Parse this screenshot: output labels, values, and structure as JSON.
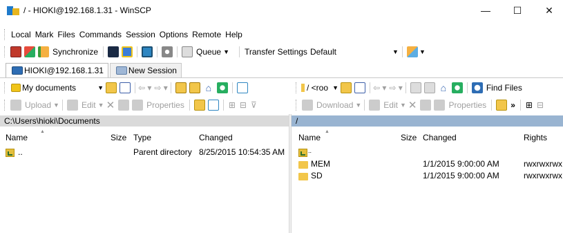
{
  "window": {
    "title": "/ - HIOKI@192.168.1.31 - WinSCP",
    "minimize": "—",
    "maximize": "☐",
    "close": "✕"
  },
  "menu": [
    "Local",
    "Mark",
    "Files",
    "Commands",
    "Session",
    "Options",
    "Remote",
    "Help"
  ],
  "toolbar": {
    "synchronize": "Synchronize",
    "queue": "Queue",
    "transfer_settings_label": "Transfer Settings",
    "transfer_settings_value": "Default"
  },
  "tabs": [
    {
      "label": "HIOKI@192.168.1.31",
      "active": true
    },
    {
      "label": "New Session",
      "active": false
    }
  ],
  "local": {
    "location": "My documents",
    "find_files": "Find Files",
    "upload": "Upload",
    "edit": "Edit",
    "properties": "Properties",
    "path": "C:\\Users\\hioki\\Documents",
    "columns": [
      "Name",
      "Size",
      "Type",
      "Changed"
    ],
    "rows": [
      {
        "name": "..",
        "size": "",
        "type": "Parent directory",
        "changed": "8/25/2015  10:54:35 AM",
        "kind": "updir"
      }
    ]
  },
  "remote": {
    "location": "/ <roo",
    "download": "Download",
    "edit": "Edit",
    "properties": "Properties",
    "overflow": "»",
    "path": "/",
    "columns": [
      "Name",
      "Size",
      "Changed",
      "Rights"
    ],
    "rows": [
      {
        "name": "..",
        "size": "",
        "changed": "",
        "rights": "",
        "kind": "updir"
      },
      {
        "name": "MEM",
        "size": "",
        "changed": "1/1/2015 9:00:00 AM",
        "rights": "rwxrwxrwx",
        "kind": "folder"
      },
      {
        "name": "SD",
        "size": "",
        "changed": "1/1/2015 9:00:00 AM",
        "rights": "rwxrwxrwx",
        "kind": "folder"
      }
    ]
  },
  "colors": {
    "remote_path_bg": "#99b4d1",
    "local_path_bg": "#dadada",
    "folder": "#f2c64a"
  }
}
